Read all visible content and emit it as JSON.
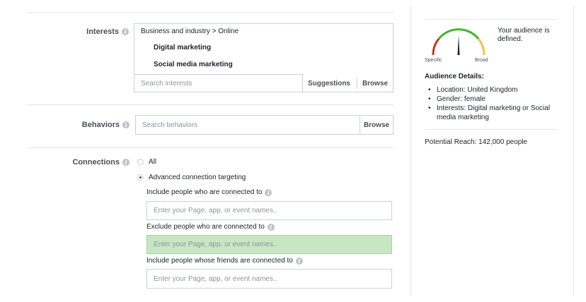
{
  "interests": {
    "label": "Interests",
    "breadcrumb": "Business and industry > Online",
    "items": [
      "Digital marketing",
      "Social media marketing"
    ],
    "search_placeholder": "Search interests",
    "suggestions_label": "Suggestions",
    "browse_label": "Browse"
  },
  "behaviors": {
    "label": "Behaviors",
    "search_placeholder": "Search behaviors",
    "browse_label": "Browse"
  },
  "connections": {
    "label": "Connections",
    "option_all": "All",
    "option_advanced": "Advanced connection targeting",
    "selected": "advanced",
    "include_label": "Include people who are connected to",
    "include_placeholder": "Enter your Page, app, or event names..",
    "exclude_label": "Exclude people who are connected to",
    "exclude_placeholder": "Enter your Page, app, or event names..",
    "friends_label": "Include people whose friends are connected to",
    "friends_placeholder": "Enter your Page, app, or event names.."
  },
  "audience": {
    "status_text": "Your audience is defined.",
    "gauge_specific": "Specific",
    "gauge_broad": "Broad",
    "gauge_level": 0.5,
    "details_title": "Audience Details:",
    "details": [
      "Location: United Kingdom",
      "Gender: female",
      "Interests: Digital marketing or Social media marketing"
    ],
    "reach_text": "Potential Reach: 142,000 people"
  },
  "colors": {
    "highlight_field": "#c7e6c4",
    "gauge_red": "#c0392b",
    "gauge_yellow": "#f0c05a",
    "gauge_green": "#42b72a"
  }
}
